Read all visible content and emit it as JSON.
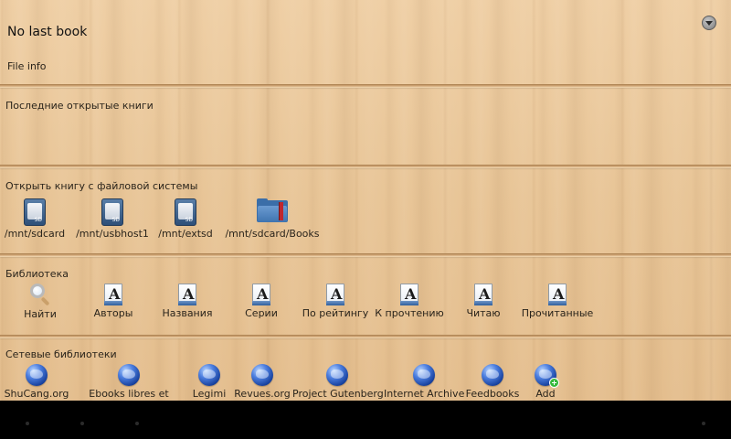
{
  "header": {
    "title": "No last book",
    "menu_icon": "chevron-down-icon"
  },
  "file_info": {
    "label": "File info"
  },
  "recent": {
    "label": "Последние открытые книги"
  },
  "filesystem": {
    "label": "Открыть книгу с файловой системы",
    "items": [
      {
        "label": "/mnt/sdcard",
        "icon": "sd-card-icon"
      },
      {
        "label": "/mnt/usbhost1",
        "icon": "sd-card-icon"
      },
      {
        "label": "/mnt/extsd",
        "icon": "sd-card-icon"
      },
      {
        "label": "/mnt/sdcard/Books",
        "icon": "folder-icon"
      }
    ]
  },
  "library": {
    "label": "Библиотека",
    "items": [
      {
        "label": "Найти",
        "icon": "search-icon"
      },
      {
        "label": "Авторы",
        "icon": "book-page-icon"
      },
      {
        "label": "Названия",
        "icon": "book-page-icon"
      },
      {
        "label": "Серии",
        "icon": "book-page-icon"
      },
      {
        "label": "По рейтингу",
        "icon": "book-page-icon"
      },
      {
        "label": "К прочтению",
        "icon": "book-page-icon"
      },
      {
        "label": "Читаю",
        "icon": "book-page-icon"
      },
      {
        "label": "Прочитанные",
        "icon": "book-page-icon"
      }
    ]
  },
  "network": {
    "label": "Сетевые библиотеки",
    "items": [
      {
        "label": "ShuCang.org",
        "icon": "globe-icon"
      },
      {
        "label": "Ebooks libres et",
        "icon": "globe-icon"
      },
      {
        "label": "Legimi",
        "icon": "globe-icon"
      },
      {
        "label": "Revues.org",
        "icon": "globe-icon"
      },
      {
        "label": "Project Gutenberg",
        "icon": "globe-icon"
      },
      {
        "label": "Internet Archive",
        "icon": "globe-icon"
      },
      {
        "label": "Feedbooks",
        "icon": "globe-icon"
      },
      {
        "label": "Add",
        "icon": "globe-add-icon"
      }
    ]
  },
  "colors": {
    "wood": "#e8c597",
    "plank": "#b98c58",
    "navbar": "#000000"
  }
}
